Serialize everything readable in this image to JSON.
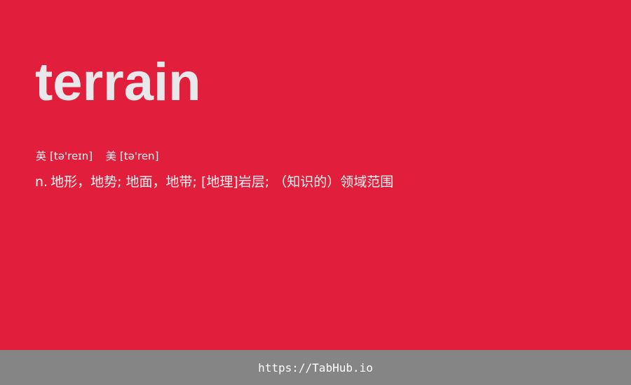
{
  "card": {
    "word": "terrain",
    "phonetics": {
      "uk_label": "英",
      "uk_ipa": "[tə'reɪn]",
      "us_label": "美",
      "us_ipa": "[tə'ren]"
    },
    "definition": {
      "part_of_speech": "n.",
      "meaning": "地形，地势; 地面，地带; [地理]岩层; （知识的）领域范围"
    }
  },
  "footer": {
    "link_text": "https://TabHub.io"
  },
  "colors": {
    "background": "#e11f3c",
    "footer_background": "#858585",
    "word_text": "#e8e8ea",
    "body_text": "#f4f4f4"
  }
}
